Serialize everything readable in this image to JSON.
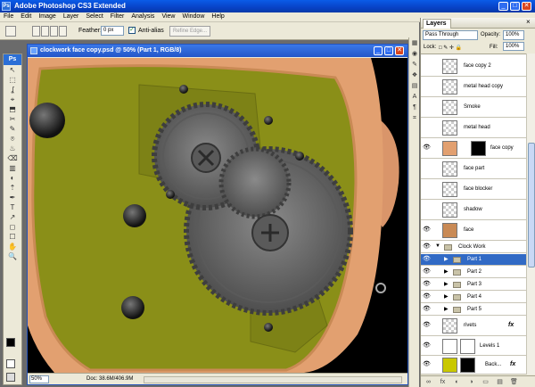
{
  "app": {
    "title": "Adobe Photoshop CS3 Extended",
    "logo": "Ps"
  },
  "window_controls": {
    "minimize": "_",
    "maximize": "□",
    "close": "✕"
  },
  "menu": [
    "File",
    "Edit",
    "Image",
    "Layer",
    "Select",
    "Filter",
    "Analysis",
    "View",
    "Window",
    "Help"
  ],
  "options": {
    "feather_label": "Feather:",
    "feather_value": "0 px",
    "antialias_label": "Anti-alias",
    "antialias_checked": "✓",
    "refine_edge_label": "Refine Edge..."
  },
  "document": {
    "title": "clockwork face copy.psd @ 50% (Part 1, RGB/8)",
    "zoom": "50%",
    "doc_size": "Doc: 38.6M/406.9M"
  },
  "toolbox": {
    "logo": "Ps",
    "tools": [
      "↖",
      "⬚",
      "ʆ",
      "⌖",
      "⬒",
      "✂",
      "✎",
      "⌾",
      "♨",
      "⌫",
      "▥",
      "◐",
      "⇡",
      "✒",
      "T",
      "↗",
      "◻",
      "☐",
      "✋",
      "🔍"
    ],
    "foreground": "#000000",
    "background": "#ffffff"
  },
  "dock_icons": [
    "▦",
    "◉",
    "✎",
    "❖",
    "▤",
    "A",
    "¶",
    "⌗"
  ],
  "layers_panel": {
    "tab": "Layers",
    "close": "×",
    "blend_mode": "Pass Through",
    "opacity_label": "Opacity:",
    "opacity": "100%",
    "lock_label": "Lock:",
    "fill_label": "Fill:",
    "fill": "100%",
    "lock_icons": "□ ✎ ✛ 🔒",
    "layers": [
      {
        "name": "face copy 2",
        "type": "layer",
        "visible": ""
      },
      {
        "name": "metal head copy",
        "type": "layer",
        "visible": ""
      },
      {
        "name": "Smoke",
        "type": "layer",
        "visible": ""
      },
      {
        "name": "metal head",
        "type": "layer",
        "visible": ""
      },
      {
        "name": "face copy",
        "type": "layer",
        "visible": "👁"
      },
      {
        "name": "face part",
        "type": "layer",
        "visible": ""
      },
      {
        "name": "face blocker",
        "type": "layer",
        "visible": ""
      },
      {
        "name": "shadow",
        "type": "layer",
        "visible": ""
      },
      {
        "name": "face",
        "type": "layer",
        "visible": "👁"
      },
      {
        "name": "Clock Work",
        "type": "group",
        "visible": "👁",
        "triangle": "▼"
      },
      {
        "name": "Part 1",
        "type": "subgroup",
        "visible": "👁",
        "triangle": "▶",
        "selected": true
      },
      {
        "name": "Part 2",
        "type": "subgroup",
        "visible": "👁",
        "triangle": "▶"
      },
      {
        "name": "Part 3",
        "type": "subgroup",
        "visible": "👁",
        "triangle": "▶"
      },
      {
        "name": "Part 4",
        "type": "subgroup",
        "visible": "👁",
        "triangle": "▶"
      },
      {
        "name": "Part 5",
        "type": "subgroup",
        "visible": "👁",
        "triangle": "▶"
      },
      {
        "name": "rivets",
        "type": "layer",
        "visible": "👁",
        "fx": "fx"
      },
      {
        "name": "Levels 1",
        "type": "adjustment",
        "visible": "👁"
      },
      {
        "name": "detail",
        "type": "layer",
        "visible": "👁",
        "fx": "fx"
      },
      {
        "name": "Back...",
        "type": "layer",
        "visible": "👁",
        "fx": "fx"
      }
    ],
    "footer_icons": [
      "∞",
      "fx",
      "◐",
      "◑",
      "▭",
      "▤",
      "🗑"
    ]
  },
  "colors": {
    "accent": "#316ac5",
    "title_bar": "#0842c7",
    "olive_panel": "#8a8f18",
    "skin": "#e8a777",
    "metal": "#6e6e6e"
  }
}
